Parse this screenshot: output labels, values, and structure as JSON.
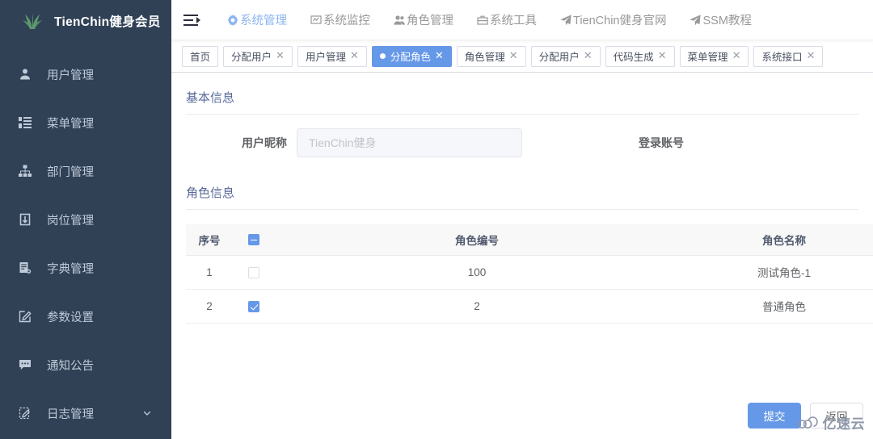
{
  "sidebar": {
    "logo_text": "TienChin健身会员",
    "logo_icon": "plant-leaf-icon",
    "items": [
      {
        "label": "用户管理",
        "icon": "user-icon",
        "has_arrow": false
      },
      {
        "label": "菜单管理",
        "icon": "menu-list-icon",
        "has_arrow": false
      },
      {
        "label": "部门管理",
        "icon": "org-tree-icon",
        "has_arrow": false
      },
      {
        "label": "岗位管理",
        "icon": "badge-icon",
        "has_arrow": false
      },
      {
        "label": "字典管理",
        "icon": "book-icon",
        "has_arrow": false
      },
      {
        "label": "参数设置",
        "icon": "edit-square-icon",
        "has_arrow": false
      },
      {
        "label": "通知公告",
        "icon": "message-icon",
        "has_arrow": false
      },
      {
        "label": "日志管理",
        "icon": "log-edit-icon",
        "has_arrow": true,
        "arrow_icon": "chevron-down-icon"
      }
    ]
  },
  "navbar": {
    "hamburger_icon": "collapse-menu-icon",
    "menu": [
      {
        "label": "系统管理",
        "icon": "gear-icon",
        "active": true
      },
      {
        "label": "系统监控",
        "icon": "monitor-icon",
        "active": false
      },
      {
        "label": "角色管理",
        "icon": "people-icon",
        "active": false
      },
      {
        "label": "系统工具",
        "icon": "toolbox-icon",
        "active": false
      },
      {
        "label": "TienChin健身官网",
        "icon": "paper-plane-icon",
        "active": false
      },
      {
        "label": "SSM教程",
        "icon": "paper-plane-icon",
        "active": false
      }
    ]
  },
  "tags": [
    {
      "label": "首页",
      "closable": false,
      "active": false
    },
    {
      "label": "分配用户",
      "closable": true,
      "active": false
    },
    {
      "label": "用户管理",
      "closable": true,
      "active": false
    },
    {
      "label": "分配角色",
      "closable": true,
      "active": true
    },
    {
      "label": "角色管理",
      "closable": true,
      "active": false
    },
    {
      "label": "分配用户",
      "closable": true,
      "active": false
    },
    {
      "label": "代码生成",
      "closable": true,
      "active": false
    },
    {
      "label": "菜单管理",
      "closable": true,
      "active": false
    },
    {
      "label": "系统接口",
      "closable": true,
      "active": false
    }
  ],
  "tag_close_glyph": "✕",
  "content": {
    "basic_info_title": "基本信息",
    "nickname_label": "用户昵称",
    "nickname_value": "TienChin健身",
    "account_label": "登录账号",
    "role_info_title": "角色信息"
  },
  "table": {
    "headers": [
      "序号",
      "",
      "角色编号",
      "角色名称"
    ],
    "header_checkbox_state": "indeterminate",
    "rows": [
      {
        "index": "1",
        "checked": false,
        "role_id": "100",
        "role_name": "测试角色-1"
      },
      {
        "index": "2",
        "checked": true,
        "role_id": "2",
        "role_name": "普通角色"
      }
    ]
  },
  "footer": {
    "submit_label": "提交",
    "back_label": "返回"
  },
  "watermark": {
    "text": "亿速云",
    "icon": "cloud-icon"
  },
  "colors": {
    "sidebar_bg": "#304156",
    "sidebar_text": "#bfcbd9",
    "accent": "#6698e8",
    "section_title": "#5a6a99",
    "table_header_bg": "#f8f8f9"
  }
}
